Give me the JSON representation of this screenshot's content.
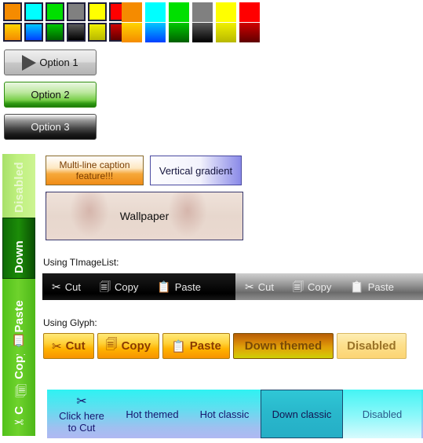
{
  "swatches": {
    "bordered_row_top": [
      "#f58b00",
      "#00ffff",
      "#00e000",
      "#808080",
      "#ffff00",
      "#ff0000"
    ],
    "bordered_row_bottom_from": [
      "#ffd400",
      "#00c8ff",
      "#00c800",
      "#5a5a5a",
      "#f0f000",
      "#d00000"
    ],
    "bordered_row_bottom_to": [
      "#f58b00",
      "#0040ff",
      "#006000",
      "#000000",
      "#b8b800",
      "#600000"
    ],
    "flat_row_top": [
      "#f58b00",
      "#00ffff",
      "#00e000",
      "#808080",
      "#ffff00",
      "#ff0000"
    ],
    "flat_row_bottom_from": [
      "#ffd400",
      "#00c8ff",
      "#00c800",
      "#5a5a5a",
      "#f0f000",
      "#d00000"
    ],
    "flat_row_bottom_to": [
      "#f58b00",
      "#0040ff",
      "#006000",
      "#000000",
      "#b8b800",
      "#600000"
    ]
  },
  "options": {
    "option1": "Option 1",
    "option2": "Option 2",
    "option3": "Option 3",
    "play_icon": "play-triangle-icon"
  },
  "sidebar": {
    "tabs": [
      {
        "label": "Disabled",
        "icon": ""
      },
      {
        "label": "Down",
        "icon": ""
      },
      {
        "label": "Paste",
        "icon": "📋"
      },
      {
        "label": "Copy",
        "icon": "🗐"
      },
      {
        "label": "Cut",
        "icon": "✂"
      }
    ]
  },
  "content": {
    "multiline_button": "Multi-line caption\nfeature!!!",
    "multiline_button_line1": "Multi-line caption",
    "multiline_button_line2": "feature!!!",
    "vertical_gradient_button": "Vertical gradient",
    "wallpaper_button": "Wallpaper",
    "imagelist_label": "Using TImageList:",
    "glyph_label": "Using Glyph:",
    "toolbar_dark": [
      {
        "label": "Cut",
        "icon": "✂"
      },
      {
        "label": "Copy",
        "icon": "🗐"
      },
      {
        "label": "Paste",
        "icon": "📋"
      }
    ],
    "toolbar_gray": [
      {
        "label": "Cut",
        "icon": "✂"
      },
      {
        "label": "Copy",
        "icon": "🗐"
      },
      {
        "label": "Paste",
        "icon": "📋"
      }
    ],
    "glyph_buttons": [
      {
        "label": "Cut",
        "icon": "✂"
      },
      {
        "label": "Copy",
        "icon": "🗐"
      },
      {
        "label": "Paste",
        "icon": "📋"
      },
      {
        "label": "Down themed",
        "icon": ""
      },
      {
        "label": "Disabled",
        "icon": ""
      }
    ],
    "bottom_bar": [
      {
        "label_line1": "Click here",
        "label_line2": "to Cut",
        "icon": "✂"
      },
      {
        "label_line1": "Hot themed",
        "label_line2": "",
        "icon": ""
      },
      {
        "label_line1": "Hot classic",
        "label_line2": "",
        "icon": ""
      },
      {
        "label_line1": "Down classic",
        "label_line2": "",
        "icon": ""
      },
      {
        "label_line1": "Disabled",
        "label_line2": "",
        "icon": ""
      }
    ]
  },
  "colors": {
    "green_accent": "#5cc721",
    "orange_accent": "#ffb300",
    "cyan_accent": "#2ff2f2",
    "blue_accent": "#8a8ae8"
  }
}
